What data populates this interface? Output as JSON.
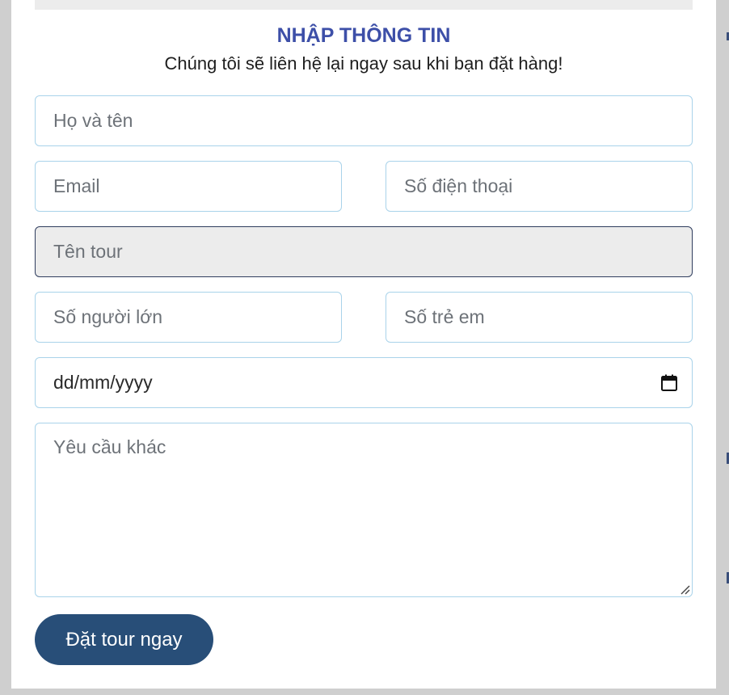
{
  "form": {
    "title": "NHẬP THÔNG TIN",
    "subtitle": "Chúng tôi sẽ liên hệ lại ngay sau khi bạn đặt hàng!",
    "fields": {
      "full_name": {
        "placeholder": "Họ và tên",
        "value": ""
      },
      "email": {
        "placeholder": "Email",
        "value": ""
      },
      "phone": {
        "placeholder": "Số điện thoại",
        "value": ""
      },
      "tour_name": {
        "placeholder": "Tên tour",
        "value": "",
        "readonly": true
      },
      "adults": {
        "placeholder": "Số người lớn",
        "value": ""
      },
      "children": {
        "placeholder": "Số trẻ em",
        "value": ""
      },
      "date": {
        "placeholder": "dd/mm/yyyy",
        "value": "",
        "icon": "calendar-icon"
      },
      "notes": {
        "placeholder": "Yêu cầu khác",
        "value": ""
      }
    },
    "submit_label": "Đặt tour ngay"
  },
  "colors": {
    "title": "#3d4fa8",
    "button_bg": "#284e78",
    "input_border": "#a9d3ea",
    "readonly_bg": "#ececec",
    "page_bg": "#cfcfcf"
  }
}
